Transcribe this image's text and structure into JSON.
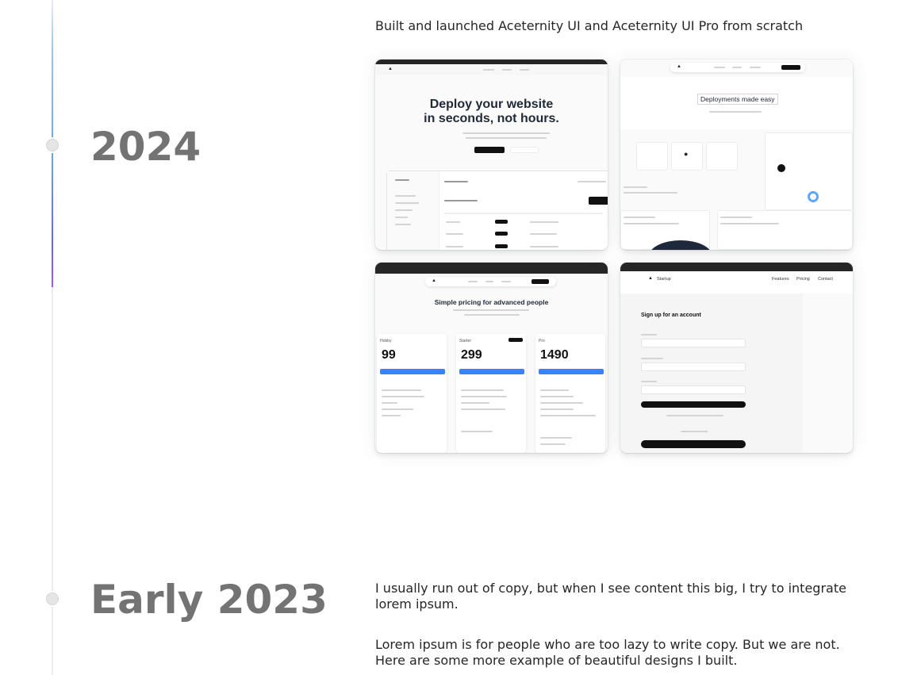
{
  "timeline": [
    {
      "year": "2024",
      "description": "Built and launched Aceternity UI and Aceternity UI Pro from scratch",
      "screens": [
        {
          "headline_1": "Deploy your website",
          "headline_2": "in seconds, not hours."
        },
        {
          "headline": "Deployments made easy"
        },
        {
          "headline": "Simple pricing for advanced people",
          "prices": [
            "99",
            "299",
            "1490"
          ],
          "plans": [
            "Hobby",
            "Starter",
            "Pro"
          ]
        },
        {
          "brand": "Startup",
          "nav": [
            "Features",
            "Pricing",
            "Contact"
          ],
          "headline": "Sign up for an account"
        }
      ]
    },
    {
      "year": "Early 2023",
      "paragraph_1": "I usually run out of copy, but when I see content this big, I try to integrate lorem ipsum.",
      "paragraph_2": "Lorem ipsum is for people who are too lazy to write copy. But we are not. Here are some more example of beautiful designs I built."
    }
  ],
  "colors": {
    "rail_gradient": [
      "#93c5fd",
      "#60a5fa",
      "#6366f1",
      "#a855f7"
    ],
    "year_text": "#737373",
    "body_text": "#262626",
    "primary_button": "#3b82f6"
  }
}
